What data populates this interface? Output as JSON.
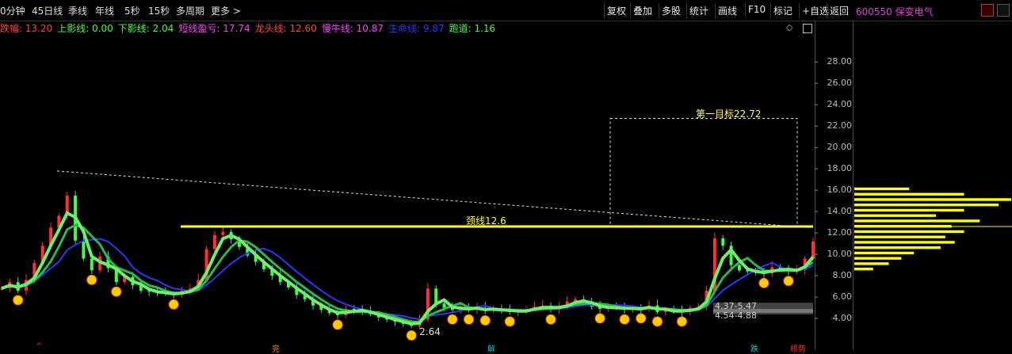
{
  "periods": [
    "0分钟",
    "45日线",
    "季线",
    "年线",
    "5秒",
    "15秒",
    "多周期",
    "更多 >"
  ],
  "toolbar": [
    "复权",
    "叠加",
    "多股",
    "统计",
    "画线",
    "F10",
    "标记",
    "+自选",
    "返回"
  ],
  "stock": {
    "code_name": "600550 保变电气"
  },
  "legend": [
    {
      "label": "跌幅:",
      "value": "13.20",
      "color": "#ff4040"
    },
    {
      "label": "上影线:",
      "value": "0.00",
      "color": "#40ff40"
    },
    {
      "label": "下影线:",
      "value": "2.04",
      "color": "#40ff40"
    },
    {
      "label": "短线盈亏:",
      "value": "17.74",
      "color": "#ff40ff"
    },
    {
      "label": "龙头线:",
      "value": "12.60",
      "color": "#ff4040"
    },
    {
      "label": "慢牛线:",
      "value": "10.87",
      "color": "#ff40ff"
    },
    {
      "label": "生命线:",
      "value": "9.87",
      "color": "#3333ff"
    },
    {
      "label": "跑道:",
      "value": "1.16",
      "color": "#40ff40"
    }
  ],
  "annotations": {
    "neckline": "颈线12.6",
    "target": "第一目标22.72",
    "low_label": "2.64",
    "range1": "4.37-5.47",
    "range2": "4.54-4.88"
  },
  "bottom_marks": [
    {
      "text": "^",
      "color": "#ff3030"
    },
    {
      "text": "完",
      "color": "#ff8c1a"
    },
    {
      "text": "解",
      "color": "#20c0c0"
    },
    {
      "text": "跌",
      "color": "#20c0c0"
    },
    {
      "text": "顺势",
      "color": "#ff3030"
    }
  ],
  "colors": {
    "up": "#ff3030",
    "down": "#40ff40",
    "neck": "#ffff00",
    "volume_profile": "#ffff00",
    "fast_ma": "#6cf06c",
    "mid_ma": "#2db84d",
    "slow_ma": "#3333ff"
  },
  "chart_data": {
    "type": "line",
    "title": "",
    "xlabel": "",
    "ylabel": "",
    "ylim": [
      2.6,
      29.5
    ],
    "yticks": [
      4,
      6,
      8,
      10,
      12,
      14,
      16,
      18,
      20,
      22,
      24,
      26,
      28
    ],
    "ytick_labels": [
      "4.00",
      "6.00",
      "8.00",
      "10.00",
      "12.00",
      "14.00",
      "16.00",
      "18.00",
      "20.00",
      "22.00",
      "24.00",
      "26.00",
      "28.00"
    ],
    "series": [
      {
        "values": [
          6.8,
          7.4,
          6.6,
          7.6,
          9.2,
          10.8,
          12.5,
          13.6,
          15.5,
          11.3,
          9.6,
          8.5,
          9.8,
          8.7,
          7.4,
          7.9,
          7.1,
          6.6,
          6.5,
          6.4,
          6.3,
          6.2,
          6.6,
          6.8,
          7.6,
          10.5,
          11.8,
          12.1,
          11.4,
          10.7,
          9.9,
          9.3,
          8.6,
          8.0,
          7.4,
          6.9,
          6.2,
          5.8,
          5.2,
          4.8,
          4.5,
          4.3,
          4.9,
          4.8,
          4.6,
          4.4,
          4.1,
          3.9,
          3.7,
          3.5,
          3.3,
          3.9,
          6.8,
          5.4,
          5.0,
          4.8,
          5.1,
          4.8,
          5.0,
          4.7,
          4.9,
          4.8,
          4.6,
          4.7,
          4.8,
          5.1,
          5.2,
          4.8,
          5.1,
          5.6,
          5.8,
          5.5,
          5.1,
          4.9,
          5.1,
          5.0,
          4.8,
          5.0,
          4.9,
          5.2,
          4.6,
          4.8,
          4.7,
          4.6,
          5.0,
          5.1,
          6.6,
          11.5,
          10.8,
          9.0,
          8.5,
          8.4,
          8.3,
          8.2,
          8.8,
          8.6,
          8.4,
          8.5,
          9.6,
          11.2
        ]
      }
    ],
    "reference_lines": [
      {
        "label": "颈线12.6",
        "y": 12.6
      },
      {
        "label": "第一目标22.72",
        "y": 22.72
      },
      {
        "label": "trend_from",
        "y": 17.8
      },
      {
        "label": "trend_to",
        "y": 12.5
      }
    ],
    "low_point": 2.64,
    "ranges": [
      [
        4.37,
        5.47
      ],
      [
        4.54,
        4.88
      ]
    ],
    "volume_profile": {
      "price": [
        8.5,
        9.0,
        9.5,
        10.0,
        10.5,
        11.0,
        11.5,
        12.0,
        12.5,
        13.0,
        13.5,
        14.0,
        14.5,
        15.0,
        15.5,
        16.0
      ],
      "weight": [
        0.12,
        0.22,
        0.3,
        0.38,
        0.55,
        0.64,
        0.58,
        0.7,
        0.62,
        0.8,
        0.52,
        0.7,
        0.92,
        1.0,
        0.7,
        0.35
      ]
    },
    "legend_position": "top-left",
    "grid": false
  }
}
